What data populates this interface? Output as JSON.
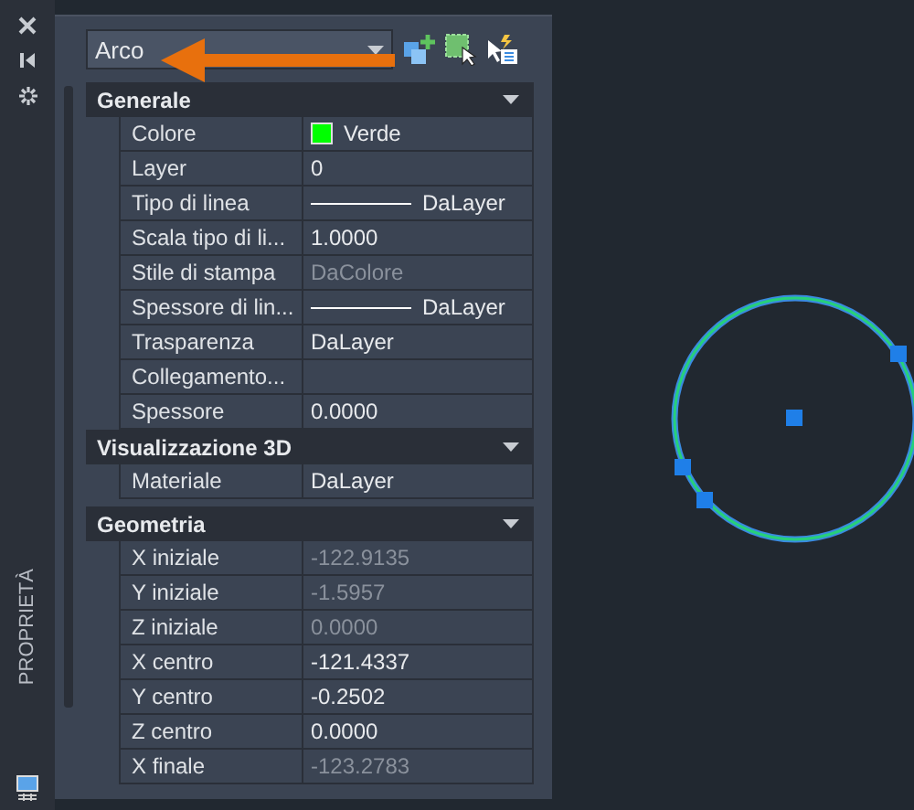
{
  "side_strip": {
    "title": "PROPRIETÀ"
  },
  "object_selector": {
    "value": "Arco"
  },
  "sections": [
    {
      "title": "Generale",
      "expanded": true,
      "rows": [
        {
          "label": "Colore",
          "value": "Verde",
          "kind": "color",
          "color": "#00ff00",
          "disabled": false
        },
        {
          "label": "Layer",
          "value": "0",
          "kind": "text",
          "disabled": false
        },
        {
          "label": "Tipo di linea",
          "value": "DaLayer",
          "kind": "line",
          "disabled": false
        },
        {
          "label": "Scala tipo di li...",
          "value": "1.0000",
          "kind": "text",
          "disabled": false
        },
        {
          "label": "Stile di stampa",
          "value": "DaColore",
          "kind": "text",
          "disabled": true
        },
        {
          "label": "Spessore di lin...",
          "value": "DaLayer",
          "kind": "line",
          "disabled": false
        },
        {
          "label": "Trasparenza",
          "value": "DaLayer",
          "kind": "text",
          "disabled": false
        },
        {
          "label": "Collegamento...",
          "kind": "text",
          "disabled": false
        },
        {
          "label": "Spessore",
          "value": "0.0000",
          "kind": "text",
          "disabled": false
        }
      ]
    },
    {
      "title": "Visualizzazione 3D",
      "expanded": true,
      "rows": [
        {
          "label": "Materiale",
          "value": "DaLayer",
          "kind": "text",
          "disabled": false
        }
      ]
    },
    {
      "title": "Geometria",
      "expanded": true,
      "rows": [
        {
          "label": "X iniziale",
          "value": "-122.9135",
          "kind": "text",
          "disabled": true
        },
        {
          "label": "Y iniziale",
          "value": "-1.5957",
          "kind": "text",
          "disabled": true
        },
        {
          "label": "Z iniziale",
          "value": "0.0000",
          "kind": "text",
          "disabled": true
        },
        {
          "label": "X centro",
          "value": "-121.4337",
          "kind": "text",
          "disabled": false
        },
        {
          "label": "Y centro",
          "value": "-0.2502",
          "kind": "text",
          "disabled": false
        },
        {
          "label": "Z centro",
          "value": "0.0000",
          "kind": "text",
          "disabled": false
        },
        {
          "label": "X finale",
          "value": "-123.2783",
          "kind": "text",
          "disabled": true
        }
      ]
    }
  ]
}
